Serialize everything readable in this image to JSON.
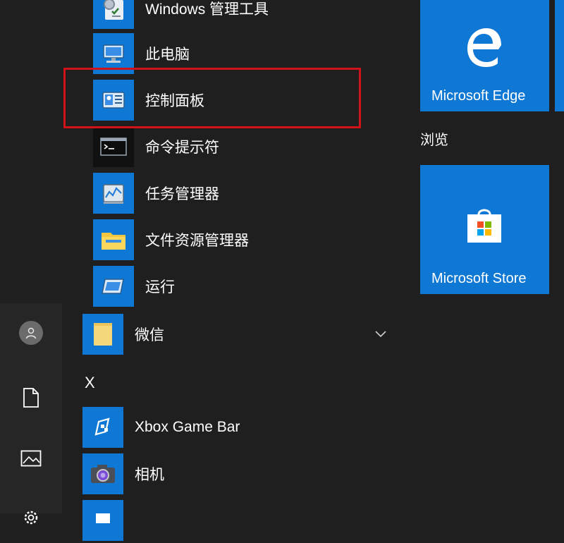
{
  "app_list": [
    {
      "label": "Windows 管理工具",
      "icon": "admin-tools-icon"
    },
    {
      "label": "此电脑",
      "icon": "this-pc-icon"
    },
    {
      "label": "控制面板",
      "icon": "control-panel-icon",
      "highlighted": true
    },
    {
      "label": "命令提示符",
      "icon": "command-prompt-icon"
    },
    {
      "label": "任务管理器",
      "icon": "task-manager-icon"
    },
    {
      "label": "文件资源管理器",
      "icon": "file-explorer-icon"
    },
    {
      "label": "运行",
      "icon": "run-icon"
    }
  ],
  "folder_wechat": {
    "label": "微信",
    "icon": "folder-icon"
  },
  "section_x": {
    "letter": "X"
  },
  "apps_x": [
    {
      "label": "Xbox Game Bar",
      "icon": "xbox-game-bar-icon"
    },
    {
      "label": "相机",
      "icon": "camera-icon"
    }
  ],
  "tiles": {
    "edge": {
      "label": "Microsoft Edge",
      "icon": "edge-icon"
    },
    "group_label": "浏览",
    "store": {
      "label": "Microsoft Store",
      "icon": "store-icon"
    }
  },
  "rail": [
    "user-avatar-icon",
    "documents-icon",
    "pictures-icon",
    "settings-icon"
  ],
  "colors": {
    "background": "#1f1f1f",
    "rail": "#262626",
    "accent": "#0f78d4",
    "highlight_border": "#d0121b"
  }
}
